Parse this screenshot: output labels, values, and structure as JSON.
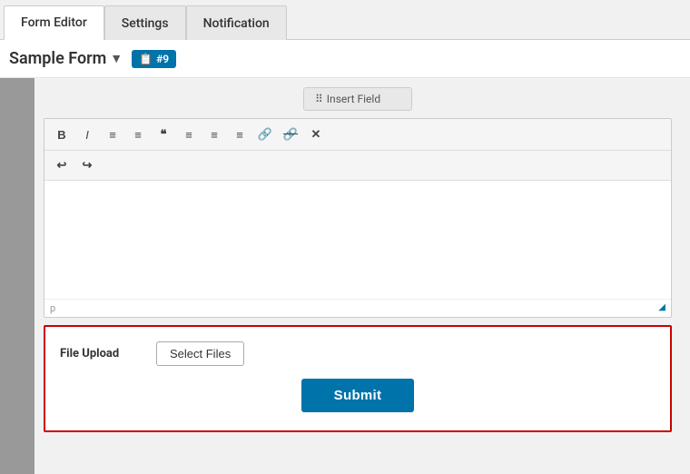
{
  "tabs": [
    {
      "label": "Form Editor",
      "active": true
    },
    {
      "label": "Settings",
      "active": false
    },
    {
      "label": "Notification",
      "active": false
    }
  ],
  "form": {
    "name": "Sample Form",
    "id_badge": "#9",
    "id_label": "#9"
  },
  "add_field_btn": "Insert Field",
  "rte": {
    "toolbar_buttons": [
      {
        "label": "B",
        "title": "Bold",
        "class": "bold"
      },
      {
        "label": "I",
        "title": "Italic",
        "class": "italic"
      },
      {
        "label": "≡",
        "title": "Unordered List"
      },
      {
        "label": "≡",
        "title": "Ordered List"
      },
      {
        "label": "❝",
        "title": "Blockquote"
      },
      {
        "label": "≡",
        "title": "Align Left"
      },
      {
        "label": "≡",
        "title": "Align Center"
      },
      {
        "label": "≡",
        "title": "Align Right"
      },
      {
        "label": "🔗",
        "title": "Link"
      },
      {
        "label": "⛓",
        "title": "Unlink"
      },
      {
        "label": "✕",
        "title": "Remove Format"
      }
    ],
    "undo_label": "↩",
    "redo_label": "↪",
    "footer_tag": "p"
  },
  "file_upload": {
    "label": "File Upload",
    "select_btn": "Select Files"
  },
  "submit_btn": "Submit"
}
